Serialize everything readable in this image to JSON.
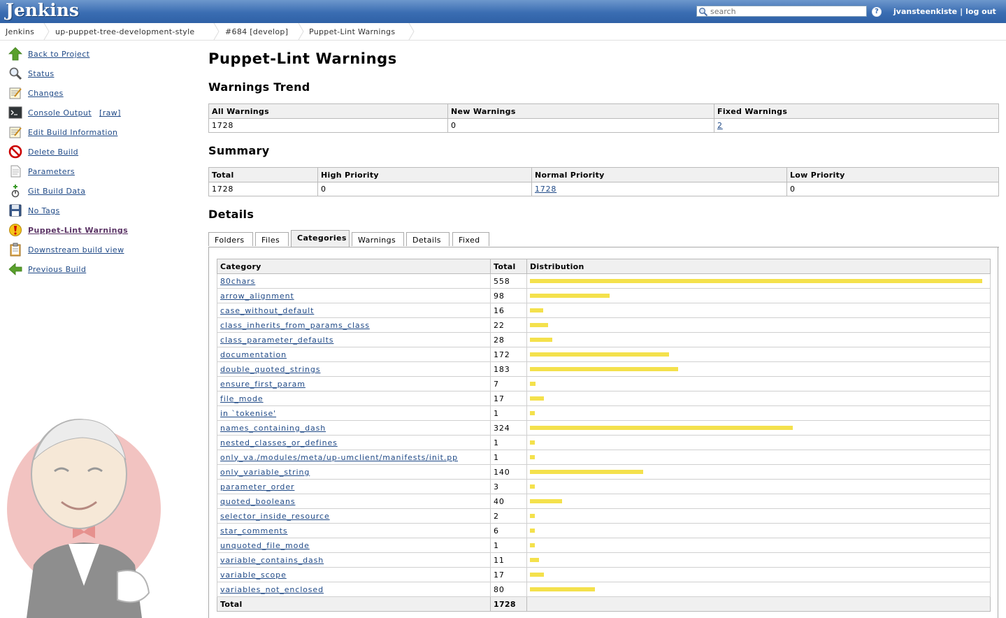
{
  "header": {
    "logo": "Jenkins",
    "search_placeholder": "search",
    "help": "?",
    "user": "jvansteenkiste",
    "logout": "log out",
    "separator": "|"
  },
  "breadcrumbs": [
    "Jenkins",
    "up-puppet-tree-development-style",
    "#684 [develop]",
    "Puppet-Lint Warnings"
  ],
  "sidebar": {
    "items": [
      {
        "label": "Back to Project",
        "icon": "up-arrow-icon"
      },
      {
        "label": "Status",
        "icon": "magnifier-icon"
      },
      {
        "label": "Changes",
        "icon": "notepad-icon"
      },
      {
        "label": "Console Output",
        "icon": "terminal-icon",
        "extra": "[raw]"
      },
      {
        "label": "Edit Build Information",
        "icon": "notepad-icon"
      },
      {
        "label": "Delete Build",
        "icon": "no-entry-icon"
      },
      {
        "label": "Parameters",
        "icon": "document-icon"
      },
      {
        "label": "Git Build Data",
        "icon": "git-icon"
      },
      {
        "label": "No Tags",
        "icon": "floppy-icon"
      },
      {
        "label": "Puppet-Lint Warnings",
        "icon": "warning-icon",
        "current": true
      },
      {
        "label": "Downstream build view",
        "icon": "clipboard-icon"
      },
      {
        "label": "Previous Build",
        "icon": "left-arrow-icon"
      }
    ]
  },
  "main": {
    "title": "Puppet-Lint Warnings",
    "trend": {
      "heading": "Warnings Trend",
      "headers": [
        "All Warnings",
        "New Warnings",
        "Fixed Warnings"
      ],
      "values": [
        "1728",
        "0",
        "2"
      ]
    },
    "summary": {
      "heading": "Summary",
      "headers": [
        "Total",
        "High Priority",
        "Normal Priority",
        "Low Priority"
      ],
      "values": [
        "1728",
        "0",
        "1728",
        "0"
      ]
    },
    "details": {
      "heading": "Details",
      "tabs": [
        "Folders",
        "Files",
        "Categories",
        "Warnings",
        "Details",
        "Fixed"
      ],
      "active_tab": "Categories",
      "columns": [
        "Category",
        "Total",
        "Distribution"
      ],
      "bar_color": "#f4e14c",
      "rows": [
        {
          "category": "80chars",
          "total": 558
        },
        {
          "category": "arrow_alignment",
          "total": 98
        },
        {
          "category": "case_without_default",
          "total": 16
        },
        {
          "category": "class_inherits_from_params_class",
          "total": 22
        },
        {
          "category": "class_parameter_defaults",
          "total": 28
        },
        {
          "category": "documentation",
          "total": 172
        },
        {
          "category": "double_quoted_strings",
          "total": 183
        },
        {
          "category": "ensure_first_param",
          "total": 7
        },
        {
          "category": "file_mode",
          "total": 17
        },
        {
          "category": "in `tokenise'",
          "total": 1
        },
        {
          "category": "names_containing_dash",
          "total": 324
        },
        {
          "category": "nested_classes_or_defines",
          "total": 1
        },
        {
          "category": "only_va./modules/meta/up-umclient/manifests/init.pp",
          "total": 1
        },
        {
          "category": "only_variable_string",
          "total": 140
        },
        {
          "category": "parameter_order",
          "total": 3
        },
        {
          "category": "quoted_booleans",
          "total": 40
        },
        {
          "category": "selector_inside_resource",
          "total": 2
        },
        {
          "category": "star_comments",
          "total": 6
        },
        {
          "category": "unquoted_file_mode",
          "total": 1
        },
        {
          "category": "variable_contains_dash",
          "total": 11
        },
        {
          "category": "variable_scope",
          "total": 17
        },
        {
          "category": "variables_not_enclosed",
          "total": 80
        }
      ],
      "total_label": "Total",
      "total_value": "1728"
    }
  }
}
